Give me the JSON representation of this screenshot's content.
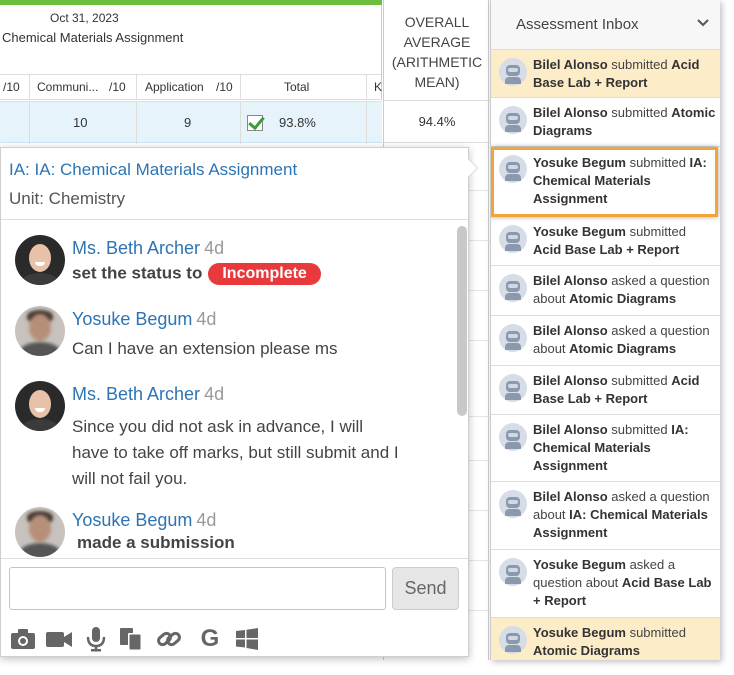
{
  "gradebook": {
    "date": "Oct 31, 2023",
    "assignment": "Chemical Materials Assignment",
    "columns": {
      "c0_out_of": "/10",
      "communication": "Communi...",
      "communication_out_of": "/10",
      "application": "Application",
      "application_out_of": "/10",
      "total": "Total",
      "next": "K"
    },
    "row": {
      "communication": "10",
      "application": "9",
      "total": "93.8%"
    },
    "overall": {
      "header_line1": "OVERALL",
      "header_line2": "AVERAGE",
      "header_line3": "(ARITHMETIC",
      "header_line4": "MEAN)",
      "value": "94.4%"
    }
  },
  "chat": {
    "title": "IA: IA: Chemical Materials Assignment",
    "unit": "Unit: Chemistry",
    "messages": [
      {
        "author": "Ms. Beth Archer",
        "time": "4d",
        "text": "set the status to",
        "status": "Incomplete"
      },
      {
        "author": "Yosuke Begum",
        "time": "4d",
        "text": "Can I have an extension please ms"
      },
      {
        "author": "Ms. Beth Archer",
        "time": "4d",
        "text": "Since you did not ask in advance, I will have to take off marks, but still submit and I will not fail you."
      },
      {
        "author": "Yosuke Begum",
        "time": "4d",
        "text": "made a submission"
      }
    ],
    "input_value": "",
    "send_label": "Send",
    "tools": [
      "camera-icon",
      "video-icon",
      "microphone-icon",
      "copy-icon",
      "link-icon",
      "google-drive-icon",
      "windows-icon"
    ],
    "google_glyph": "G",
    "colors": {
      "link": "#2c74b3",
      "status_incomplete": "#e8393c"
    }
  },
  "inbox": {
    "title": "Assessment Inbox",
    "items": [
      {
        "actor": "Bilel Alonso",
        "verb": " submitted ",
        "target": "Acid Base Lab + Report",
        "new": true
      },
      {
        "actor": "Bilel Alonso",
        "verb": " submitted ",
        "target": "Atomic Diagrams",
        "new": false
      },
      {
        "actor": "Yosuke Begum",
        "verb": " submitted ",
        "target": "IA: Chemical Materials Assignment",
        "new": false,
        "selected": true
      },
      {
        "actor": "Yosuke Begum",
        "verb": " submitted ",
        "target": "Acid Base Lab + Report",
        "new": false
      },
      {
        "actor": "Bilel Alonso",
        "verb": " asked a question about ",
        "target": "Atomic Diagrams",
        "new": false
      },
      {
        "actor": "Bilel Alonso",
        "verb": " asked a question about ",
        "target": "Atomic Diagrams",
        "new": false
      },
      {
        "actor": "Bilel Alonso",
        "verb": " submitted ",
        "target": "Acid Base Lab + Report",
        "new": false
      },
      {
        "actor": "Bilel Alonso",
        "verb": " submitted ",
        "target": "IA: Chemical Materials Assignment",
        "new": false
      },
      {
        "actor": "Bilel Alonso",
        "verb": " asked a question about ",
        "target": "IA: Chemical Materials Assignment",
        "new": false
      },
      {
        "actor": "Yosuke Begum",
        "verb": " asked a question about ",
        "target": "Acid Base Lab + Report",
        "new": false
      },
      {
        "actor": "Yosuke Begum",
        "verb": " submitted ",
        "target": "Atomic Diagrams",
        "new": true
      }
    ],
    "colors": {
      "new_item": "#fdecc8",
      "selected_border": "#f0a43a"
    }
  }
}
